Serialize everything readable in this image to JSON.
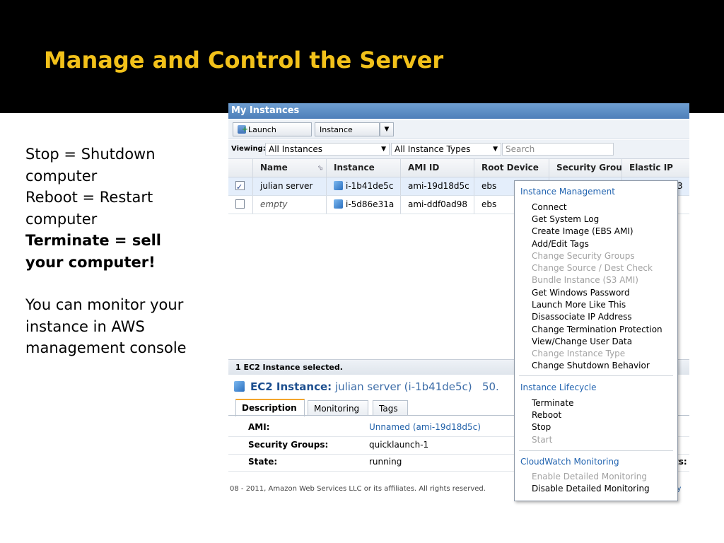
{
  "slide": {
    "title": "Manage and Control the Server",
    "notes": {
      "line1": "Stop = Shutdown computer",
      "line2": "Reboot = Restart computer",
      "line3": "Terminate = sell your computer!",
      "line4": "You can monitor your instance in AWS management console"
    }
  },
  "console": {
    "panel_title": "My Instances",
    "toolbar": {
      "launch_label": "Launch Instance",
      "actions_label": "Instance Actions"
    },
    "filters": {
      "viewing_label": "Viewing:",
      "instances_filter": "All Instances",
      "types_filter": "All Instance Types",
      "search_placeholder": "Search"
    },
    "columns": [
      "Name",
      "Instance",
      "AMI ID",
      "Root Device",
      "Security Groups",
      "Elastic IP"
    ],
    "rows": [
      {
        "name": "julian server",
        "instance": "i-1b41de5c",
        "ami": "ami-19d18d5c",
        "root": "ebs",
        "checked": true
      },
      {
        "name": "empty",
        "instance": "i-5d86e31a",
        "ami": "ami-ddf0ad98",
        "root": "ebs",
        "checked": false
      }
    ],
    "elastic_ip_partial": "3",
    "selection_status": "1 EC2 Instance selected.",
    "detail": {
      "title_key": "EC2 Instance:",
      "title_value": "julian server (i-1b41de5c)",
      "title_suffix": "50.",
      "tabs": [
        "Description",
        "Monitoring",
        "Tags"
      ],
      "fields": [
        {
          "label": "AMI:",
          "value": "Unnamed (ami-19d18d5c)"
        },
        {
          "label": "Security Groups:",
          "value": "quicklaunch-1"
        },
        {
          "label": "State:",
          "value": "running"
        }
      ],
      "right_partial": "ts:"
    },
    "footer": "08 - 2011, Amazon Web Services LLC or its affiliates. All rights reserved.",
    "footer_right": "cy"
  },
  "context_menu": {
    "sections": [
      {
        "header": "Instance Management",
        "items": [
          {
            "label": "Connect",
            "enabled": true
          },
          {
            "label": "Get System Log",
            "enabled": true
          },
          {
            "label": "Create Image (EBS AMI)",
            "enabled": true
          },
          {
            "label": "Add/Edit Tags",
            "enabled": true
          },
          {
            "label": "Change Security Groups",
            "enabled": false
          },
          {
            "label": "Change Source / Dest Check",
            "enabled": false
          },
          {
            "label": "Bundle Instance (S3 AMI)",
            "enabled": false
          },
          {
            "label": "Get Windows Password",
            "enabled": true
          },
          {
            "label": "Launch More Like This",
            "enabled": true
          },
          {
            "label": "Disassociate IP Address",
            "enabled": true
          },
          {
            "label": "Change Termination Protection",
            "enabled": true
          },
          {
            "label": "View/Change User Data",
            "enabled": true
          },
          {
            "label": "Change Instance Type",
            "enabled": false
          },
          {
            "label": "Change Shutdown Behavior",
            "enabled": true
          }
        ]
      },
      {
        "header": "Instance Lifecycle",
        "items": [
          {
            "label": "Terminate",
            "enabled": true
          },
          {
            "label": "Reboot",
            "enabled": true
          },
          {
            "label": "Stop",
            "enabled": true
          },
          {
            "label": "Start",
            "enabled": false
          }
        ]
      },
      {
        "header": "CloudWatch Monitoring",
        "items": [
          {
            "label": "Enable Detailed Monitoring",
            "enabled": false
          },
          {
            "label": "Disable Detailed Monitoring",
            "enabled": true
          }
        ]
      }
    ]
  },
  "colors": {
    "title": "#f2c11a",
    "header_bar": "#4d7fb9",
    "menu_header": "#2264b0",
    "disabled": "#a2a2a2"
  }
}
